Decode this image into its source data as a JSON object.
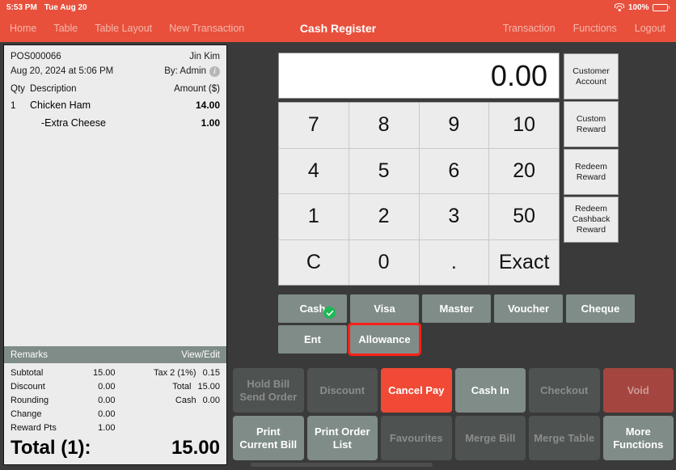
{
  "statusbar": {
    "time": "5:53 PM",
    "date": "Tue Aug 20",
    "battery_percent": "100%",
    "wifi_icon": "wifi-icon",
    "battery_icon": "battery-icon"
  },
  "navbar": {
    "title": "Cash Register",
    "left_items": [
      {
        "label": "Home"
      },
      {
        "label": "Table"
      },
      {
        "label": "Table Layout"
      },
      {
        "label": "New Transaction"
      }
    ],
    "right_items": [
      {
        "label": "Transaction"
      },
      {
        "label": "Functions"
      },
      {
        "label": "Logout"
      }
    ]
  },
  "receipt": {
    "order_no": "POS000066",
    "customer": "Jin Kim",
    "datetime": "Aug 20, 2024 at 5:06 PM",
    "cashier": "By: Admin",
    "info_icon": "info-icon",
    "columns": {
      "qty": "Qty",
      "description": "Description",
      "amount": "Amount ($)"
    },
    "items": [
      {
        "qty": "1",
        "description": "Chicken Ham",
        "amount": "14.00",
        "modifier": false
      },
      {
        "qty": "",
        "description": "-Extra Cheese",
        "amount": "1.00",
        "modifier": true
      }
    ],
    "remarks_label": "Remarks",
    "view_edit_label": "View/Edit",
    "summary_left": [
      {
        "label": "Subtotal",
        "value": "15.00"
      },
      {
        "label": "Discount",
        "value": "0.00"
      },
      {
        "label": "Rounding",
        "value": "0.00"
      },
      {
        "label": "Change",
        "value": "0.00"
      },
      {
        "label": "Reward Pts",
        "value": "1.00"
      }
    ],
    "summary_right": [
      {
        "label": "Tax 2 (1%)",
        "value": "0.15"
      },
      {
        "label": "Total",
        "value": "15.00"
      },
      {
        "label": "Cash",
        "value": "0.00"
      }
    ],
    "total_label": "Total (1):",
    "total_value": "15.00"
  },
  "register": {
    "amount_display": "0.00",
    "keypad": [
      {
        "label": "7"
      },
      {
        "label": "8"
      },
      {
        "label": "9"
      },
      {
        "label": "10"
      },
      {
        "label": "4"
      },
      {
        "label": "5"
      },
      {
        "label": "6"
      },
      {
        "label": "20"
      },
      {
        "label": "1"
      },
      {
        "label": "2"
      },
      {
        "label": "3"
      },
      {
        "label": "50"
      },
      {
        "label": "C"
      },
      {
        "label": "0"
      },
      {
        "label": "."
      },
      {
        "label": "Exact"
      }
    ],
    "side_buttons": [
      {
        "label": "Customer Account"
      },
      {
        "label": "Custom Reward"
      },
      {
        "label": "Redeem Reward"
      },
      {
        "label": "Redeem Cashback Reward"
      }
    ],
    "payment_row1": [
      {
        "label": "Cash",
        "selected": true,
        "check_icon": "check-circle-icon"
      },
      {
        "label": "Visa",
        "selected": false
      },
      {
        "label": "Master",
        "selected": false
      },
      {
        "label": "Voucher",
        "selected": false
      },
      {
        "label": "Cheque",
        "selected": false
      }
    ],
    "payment_row2": [
      {
        "label": "Ent",
        "highlighted": false
      },
      {
        "label": "Allowance",
        "highlighted": true
      }
    ]
  },
  "actions": [
    {
      "label": "Hold Bill Send Order",
      "state": "disabled"
    },
    {
      "label": "Discount",
      "state": "disabled"
    },
    {
      "label": "Cancel Pay",
      "state": "danger"
    },
    {
      "label": "Cash In",
      "state": "enabled"
    },
    {
      "label": "Checkout",
      "state": "disabled"
    },
    {
      "label": "Void",
      "state": "void"
    },
    {
      "label": "Print Current Bill",
      "state": "enabled"
    },
    {
      "label": "Print Order List",
      "state": "enabled"
    },
    {
      "label": "Favourites",
      "state": "disabled"
    },
    {
      "label": "Merge Bill",
      "state": "disabled"
    },
    {
      "label": "Merge Table",
      "state": "disabled"
    },
    {
      "label": "More Functions",
      "state": "enabled"
    }
  ],
  "colors": {
    "brand_red": "#e8503c",
    "background": "#3a3a3a",
    "button_gray": "#7f8c88",
    "button_disabled": "#4e5250",
    "danger": "#f04a36",
    "void": "#a4463f",
    "check_green": "#1db954",
    "highlight_outline": "#ff2116"
  }
}
